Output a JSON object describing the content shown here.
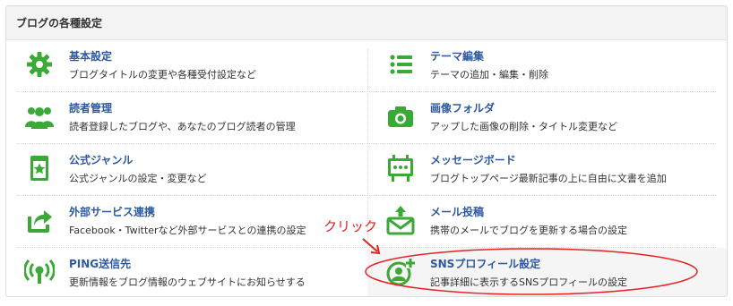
{
  "panel": {
    "title": "ブログの各種設定"
  },
  "items": [
    {
      "title": "基本設定",
      "desc": "ブログタイトルの変更や各種受付設定など",
      "icon": "gear-icon"
    },
    {
      "title": "テーマ編集",
      "desc": "テーマの追加・編集・削除",
      "icon": "list-icon"
    },
    {
      "title": "読者管理",
      "desc": "読者登録したブログや、あなたのブログ読者の管理",
      "icon": "users-icon"
    },
    {
      "title": "画像フォルダ",
      "desc": "アップした画像の削除・タイトル変更など",
      "icon": "camera-icon"
    },
    {
      "title": "公式ジャンル",
      "desc": "公式ジャンルの設定・変更など",
      "icon": "star-bookmark-icon"
    },
    {
      "title": "メッセージボード",
      "desc": "ブログトップページ最新記事の上に自由に文書を追加",
      "icon": "message-board-icon"
    },
    {
      "title": "外部サービス連携",
      "desc": "Facebook・Twitterなど外部サービスとの連携の設定",
      "icon": "share-icon"
    },
    {
      "title": "メール投稿",
      "desc": "携帯のメールでブログを更新する場合の設定",
      "icon": "mail-upload-icon"
    },
    {
      "title": "PING送信先",
      "desc": "更新情報をブログ情報のウェブサイトにお知らせする",
      "icon": "broadcast-icon"
    },
    {
      "title": "SNSプロフィール設定",
      "desc": "記事詳細に表示するSNSプロフィールの設定",
      "icon": "profile-add-icon"
    }
  ],
  "annotation": {
    "label": "クリック",
    "color": "#e52222"
  },
  "colors": {
    "accent_green": "#3ba935",
    "link_blue": "#2d5a9e"
  }
}
